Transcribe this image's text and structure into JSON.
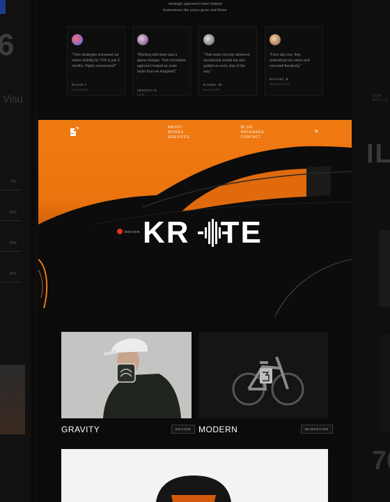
{
  "intro": {
    "line1": "strategic approach have helped",
    "line2": "businesses like yours grow and thrive"
  },
  "testimonials": [
    {
      "quote": "\"Their strategies increased our online visibility by 75% in just 3 months. Highly recommend!\"",
      "name": "DAVID J.",
      "role": "FOUNDER",
      "avatar_color": "#6aa6ff"
    },
    {
      "quote": "\"Working with them was a game-changer. Their innovative approach helped us scale faster than we imagined!\"",
      "name": "JESSICA K.",
      "role": "CEO",
      "avatar_color": "#c7a6d6"
    },
    {
      "quote": "\"Their team not only delivered exceptional results but also guided us every step of the way.\"",
      "name": "DANIEL W.",
      "role": "MANAGER",
      "avatar_color": "#bdbdbd"
    },
    {
      "quote": "\"From day one, they understood our vision and executed flawlessly.\"",
      "name": "RACHEL B.",
      "role": "MARKETING",
      "avatar_color": "#e8b48a"
    }
  ],
  "side_left": {
    "big_number": "6",
    "heading_fragment": "Visu",
    "percent_labels": [
      "70%",
      "80%",
      "60%",
      "80%"
    ]
  },
  "side_right": {
    "label": "OUR SKILLS",
    "heading_fragment": "IL",
    "big_number": "70"
  },
  "hero": {
    "nav_left": [
      "ABOUT",
      "WORKS",
      "SERVICES"
    ],
    "nav_right": [
      "BLOG",
      "PACKAGES",
      "CONTACT"
    ],
    "wordmark_left": "KR",
    "wordmark_right": "TE",
    "design_tag": "DESIGN",
    "accent": "#f07a12"
  },
  "projects": [
    {
      "title": "GRAVITY",
      "tag": "DESIGN"
    },
    {
      "title": "MODERN",
      "tag": "MARKETING"
    }
  ]
}
